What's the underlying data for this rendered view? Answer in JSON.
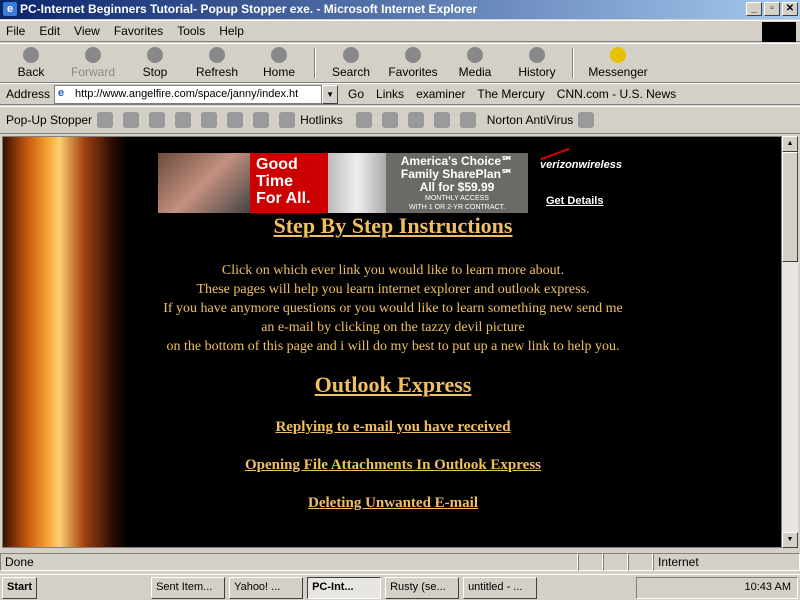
{
  "window": {
    "title": "PC-Internet Beginners Tutorial- Popup Stopper exe. - Microsoft Internet Explorer"
  },
  "menu": [
    "File",
    "Edit",
    "View",
    "Favorites",
    "Tools",
    "Help"
  ],
  "toolbar": [
    "Back",
    "Forward",
    "Stop",
    "Refresh",
    "Home",
    "Search",
    "Favorites",
    "Media",
    "History",
    "Messenger"
  ],
  "address": {
    "label": "Address",
    "url": "http://www.angelfire.com/space/janny/index.ht",
    "go": "Go",
    "links_label": "Links",
    "links": [
      "examiner",
      "The Mercury",
      "CNN.com - U.S. News"
    ]
  },
  "popup_bar": {
    "label": "Pop-Up Stopper",
    "hotlinks": "Hotlinks",
    "norton": "Norton AntiVirus"
  },
  "ad": {
    "left": "Good Time For All.",
    "line1": "America's Choice℠",
    "line2": "Family SharePlan℠",
    "price": "All for $59.99",
    "small1": "MONTHLY ACCESS",
    "small2": "WITH 1 OR 2-YR CONTRACT.",
    "brand": "verizonwireless",
    "cta": "Get Details"
  },
  "page": {
    "heading": "Step By Step Instructions",
    "paragraph": [
      "Click on which ever link you would like to learn more about.",
      "These pages will help you  learn internet explorer  and outlook express.",
      "If you have anymore questions or you would like to learn something new send me",
      "an e-mail by clicking on the tazzy devil picture",
      "on the bottom of this page and i will do my best to put up a new link to help you."
    ],
    "section": "Outlook Express",
    "links": [
      "Replying to e-mail you have received",
      "Opening File Attachments In Outlook Express",
      "Deleting Unwanted E-mail"
    ]
  },
  "status": {
    "text": "Done",
    "zone": "Internet"
  },
  "taskbar": {
    "start": "Start",
    "tasks": [
      "Sent Item...",
      "Yahoo! ...",
      "PC-Int...",
      "Rusty (se...",
      "untitled - ..."
    ],
    "clock": "10:43 AM"
  }
}
